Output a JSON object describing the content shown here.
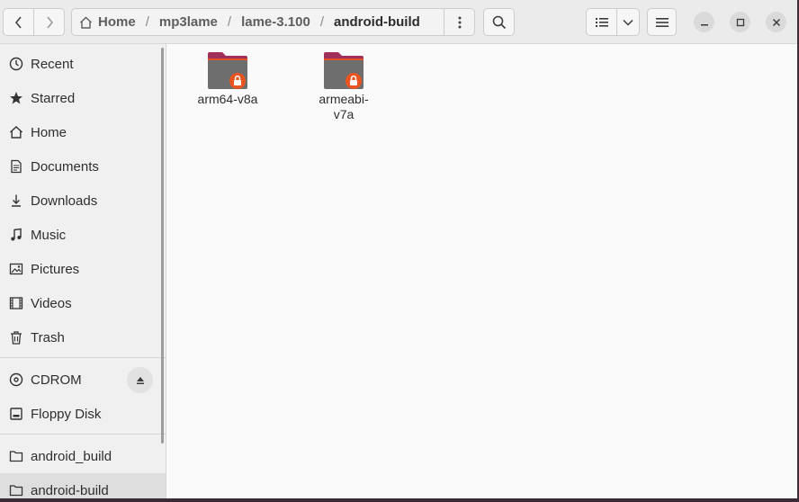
{
  "pathbar": {
    "crumbs": [
      "Home",
      "mp3lame",
      "lame-3.100",
      "android-build"
    ],
    "separator": "/"
  },
  "sidebar": {
    "places": [
      {
        "label": "Recent",
        "icon": "clock-icon"
      },
      {
        "label": "Starred",
        "icon": "star-icon"
      },
      {
        "label": "Home",
        "icon": "home-icon"
      },
      {
        "label": "Documents",
        "icon": "document-icon"
      },
      {
        "label": "Downloads",
        "icon": "download-icon"
      },
      {
        "label": "Music",
        "icon": "music-icon"
      },
      {
        "label": "Pictures",
        "icon": "picture-icon"
      },
      {
        "label": "Videos",
        "icon": "video-icon"
      },
      {
        "label": "Trash",
        "icon": "trash-icon"
      }
    ],
    "devices": [
      {
        "label": "CDROM",
        "icon": "disc-icon"
      },
      {
        "label": "Floppy Disk",
        "icon": "drive-icon"
      }
    ],
    "bookmarks": [
      {
        "label": "android_build",
        "icon": "folder-icon"
      },
      {
        "label": "android-build",
        "icon": "folder-icon"
      }
    ]
  },
  "files": [
    {
      "label": "arm64-v8a"
    },
    {
      "label": "armeabi-\nv7a"
    }
  ],
  "colors": {
    "folder_back": "#a0305a",
    "folder_front": "#6e6e6e",
    "folder_tab": "#e0522a",
    "lock_badge": "#e95420"
  }
}
